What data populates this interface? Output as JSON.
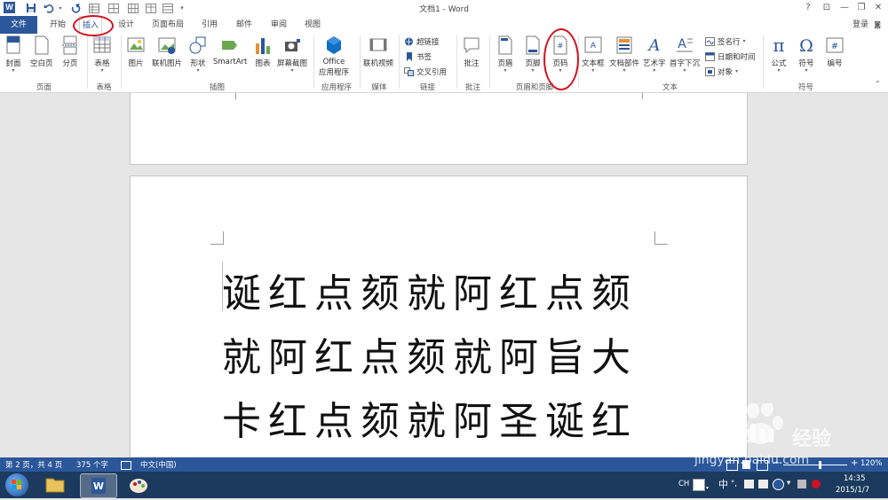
{
  "window": {
    "title": "文档1 - Word",
    "app_logo": "W",
    "controls": [
      "?",
      "⊡",
      "—",
      "❐",
      "✕"
    ],
    "quick_access": [
      "save-icon",
      "undo-icon",
      "redo-icon",
      "table-icon",
      "table-icon",
      "table-icon",
      "customize-icon"
    ]
  },
  "tabs": {
    "file": "文件",
    "items": [
      "开始",
      "插入",
      "设计",
      "页面布局",
      "引用",
      "邮件",
      "审阅",
      "视图"
    ],
    "active": "插入",
    "login": "登录"
  },
  "ribbon": {
    "pages": {
      "cover": "封面",
      "blank": "空白页",
      "break": "分页",
      "group": "页面"
    },
    "tables": {
      "table": "表格",
      "group": "表格"
    },
    "illustrations": {
      "picture": "图片",
      "online_picture": "联机图片",
      "shapes": "形状",
      "smartart": "SmartArt",
      "chart": "图表",
      "screenshot": "屏幕截图",
      "group": "插图"
    },
    "apps": {
      "office_line1": "Office",
      "office_line2": "应用程序",
      "group": "应用程序"
    },
    "media": {
      "online_video": "联机视频",
      "group": "媒体"
    },
    "links": {
      "hyperlink": "超链接",
      "bookmark": "书签",
      "cross_ref": "交叉引用",
      "group": "链接"
    },
    "comments": {
      "comment": "批注",
      "group": "批注"
    },
    "header_footer": {
      "header": "页眉",
      "footer": "页脚",
      "page_number": "页码",
      "group": "页眉和页脚"
    },
    "text": {
      "textbox": "文本框",
      "quick_parts": "文档部件",
      "wordart": "艺术字",
      "dropcap": "首字下沉",
      "signature": "签名行",
      "datetime": "日期和时间",
      "object": "对象",
      "group": "文本"
    },
    "symbols": {
      "equation": "公式",
      "symbol": "符号",
      "numbering": "编号",
      "group": "符号"
    }
  },
  "document": {
    "lines": [
      "诞红点颏就阿红点颏",
      "就阿红点颏就阿旨大",
      "卡红点颏就阿圣诞红"
    ]
  },
  "status": {
    "page": "第 2 页，共 4 页",
    "words": "375 个字",
    "language": "中文(中国)",
    "zoom": "120%",
    "zoom_minus": "−",
    "zoom_plus": "+"
  },
  "taskbar": {
    "ime": "CH",
    "ime_mode": "中",
    "time": "14:35",
    "date": "2015/1/7"
  },
  "watermark": {
    "brand": "Baidu",
    "brand_cn": "经验",
    "url": "jingyan.baidu.com"
  }
}
